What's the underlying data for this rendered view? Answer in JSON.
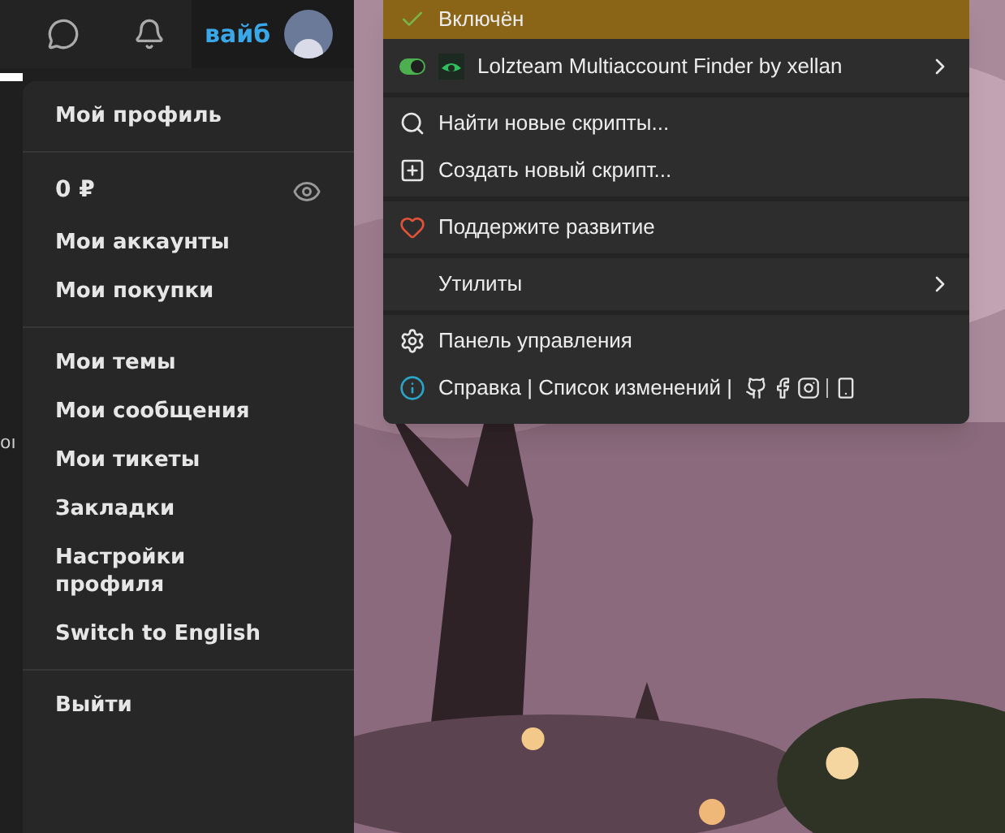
{
  "header": {
    "username": "вайб"
  },
  "account_menu": {
    "groups": [
      {
        "items": [
          {
            "kind": "link",
            "label": "Мой профиль"
          }
        ]
      },
      {
        "items": [
          {
            "kind": "balance",
            "label": "0 ₽"
          },
          {
            "kind": "link",
            "label": "Мои аккаунты"
          },
          {
            "kind": "link",
            "label": "Мои покупки"
          }
        ]
      },
      {
        "items": [
          {
            "kind": "link",
            "label": "Мои темы"
          },
          {
            "kind": "link",
            "label": "Мои сообщения"
          },
          {
            "kind": "link",
            "label": "Мои тикеты"
          },
          {
            "kind": "link",
            "label": "Закладки"
          },
          {
            "kind": "link",
            "label": "Настройки профиля"
          },
          {
            "kind": "link",
            "label": "Switch to English"
          }
        ]
      },
      {
        "items": [
          {
            "kind": "link",
            "label": "Выйти"
          }
        ]
      }
    ]
  },
  "background_text": "oı",
  "script_menu": {
    "groups": [
      {
        "items": [
          {
            "kind": "enabled",
            "label": "Включён",
            "checked": true,
            "selected": true
          },
          {
            "kind": "script",
            "label": "Lolzteam Multiaccount Finder by xellan",
            "on": true,
            "selected": false
          }
        ]
      },
      {
        "items": [
          {
            "kind": "search",
            "label": "Найти новые скрипты...",
            "selected": false
          },
          {
            "kind": "create",
            "label": "Создать новый скрипт...",
            "selected": false
          }
        ]
      },
      {
        "items": [
          {
            "kind": "donate",
            "label": "Поддержите развитие",
            "selected": false
          }
        ]
      },
      {
        "items": [
          {
            "kind": "submenu",
            "label": "Утилиты",
            "selected": false
          }
        ]
      },
      {
        "items": [
          {
            "kind": "settings",
            "label": "Панель управления",
            "selected": false
          },
          {
            "kind": "help",
            "label": "Справка | Список изменений |",
            "selected": false
          }
        ]
      }
    ]
  }
}
